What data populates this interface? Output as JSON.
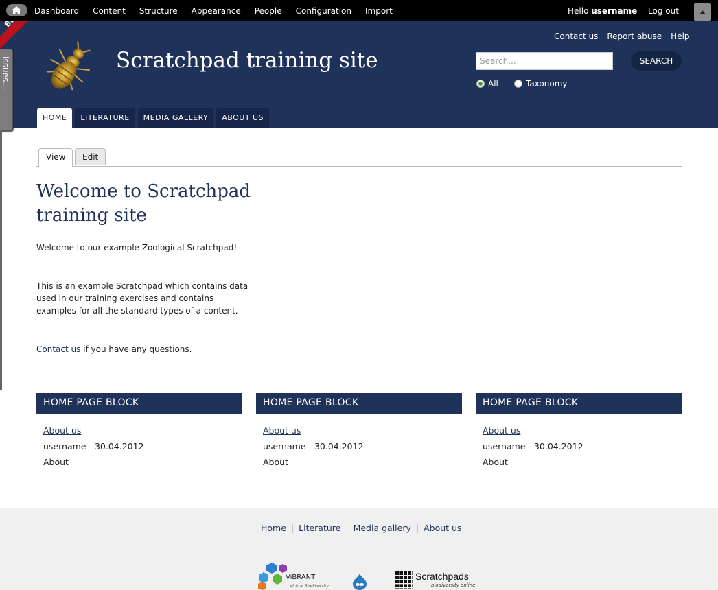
{
  "toolbar": {
    "menu": [
      "Dashboard",
      "Content",
      "Structure",
      "Appearance",
      "People",
      "Configuration",
      "Import"
    ],
    "hello_prefix": "Hello ",
    "username": "username",
    "logout": "Log out"
  },
  "side": {
    "ribbon_label": "Bu",
    "issues_label": "Issues..."
  },
  "header": {
    "site_name": "Scratchpad training site",
    "secondary_links": [
      "Contact us",
      "Report abuse",
      "Help"
    ],
    "search": {
      "placeholder": "Search...",
      "button": "SEARCH",
      "options": [
        "All",
        "Taxonomy"
      ],
      "selected": "All"
    },
    "tabs": [
      "HOME",
      "LITERATURE",
      "MEDIA GALLERY",
      "ABOUT US"
    ],
    "active_tab": "HOME"
  },
  "local_tabs": [
    "View",
    "Edit"
  ],
  "main": {
    "title": "Welcome to Scratchpad training site",
    "paragraph1": "Welcome to our example Zoological Scratchpad!",
    "paragraph2": "This is an example Scratchpad which contains data used in our training exercises and contains examples for all the standard types of a content.",
    "contact_link": "Contact us",
    "contact_suffix": " if you have any questions."
  },
  "blocks": [
    {
      "title": "HOME PAGE BLOCK",
      "link": "About us",
      "meta": "username - 30.04.2012",
      "text": "About"
    },
    {
      "title": "HOME PAGE BLOCK",
      "link": "About us",
      "meta": "username - 30.04.2012",
      "text": "About"
    },
    {
      "title": "HOME PAGE BLOCK",
      "link": "About us",
      "meta": "username - 30.04.2012",
      "text": "About"
    }
  ],
  "footer": {
    "links": [
      "Home",
      "Literature",
      "Media gallery",
      "About us"
    ],
    "vibrant_name": "ViBRANT",
    "vibrant_tagline": "Virtual Biodiversity",
    "scratchpads_name": "Scratchpads",
    "scratchpads_tagline": "biodiversity online"
  },
  "colors": {
    "brand_navy": "#1f3259",
    "toolbar_black": "#000000",
    "footer_grey": "#f0f0f0"
  }
}
